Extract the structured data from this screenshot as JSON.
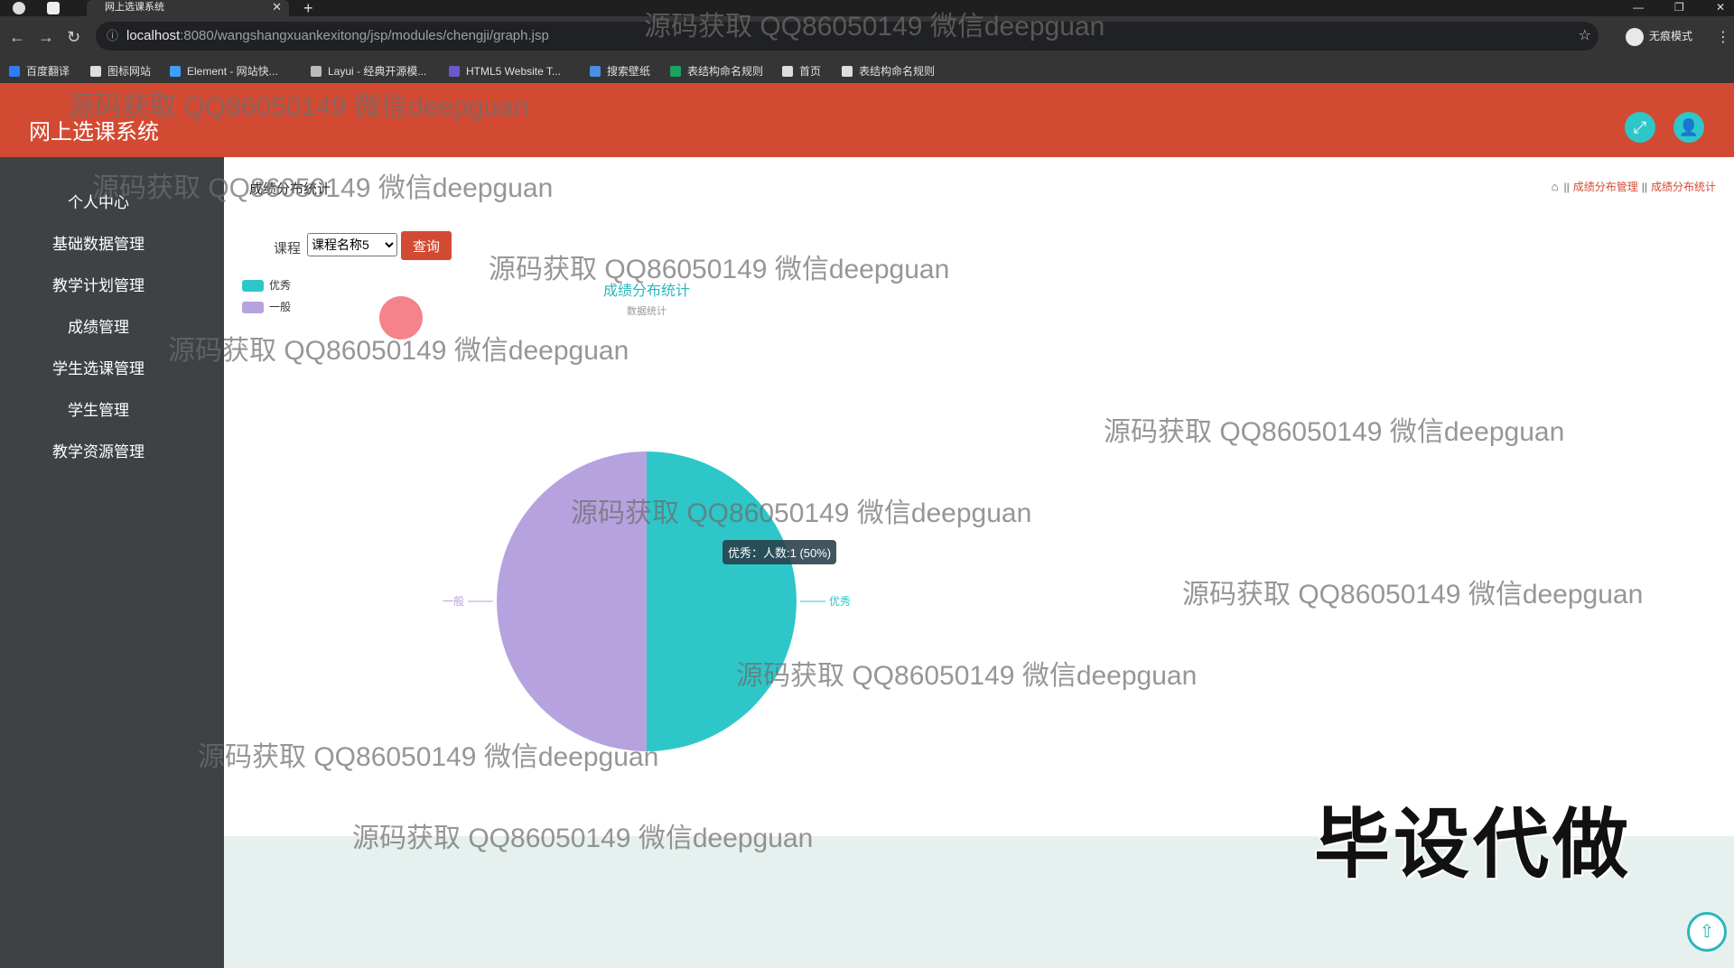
{
  "browser": {
    "tab_title": "网上选课系统",
    "url_host": "localhost",
    "url_path": ":8080/wangshangxuankexitong/jsp/modules/chengji/graph.jsp",
    "profile_label": "无痕模式",
    "bookmarks": [
      {
        "label": "百度翻译",
        "color": "#2e7cf6"
      },
      {
        "label": "图标网站",
        "color": "#dddddd"
      },
      {
        "label": "Element - 网站快...",
        "color": "#409eff"
      },
      {
        "label": "Layui - 经典开源模...",
        "color": "#bbbbbb"
      },
      {
        "label": "HTML5 Website T...",
        "color": "#6a5acd"
      },
      {
        "label": "搜索壁纸",
        "color": "#4a90e2"
      },
      {
        "label": "表结构命名规则",
        "color": "#1aa260"
      },
      {
        "label": "首页",
        "color": "#dddddd"
      },
      {
        "label": "表结构命名规则",
        "color": "#dddddd"
      }
    ]
  },
  "header": {
    "title": "网上选课系统",
    "color": "#d34a33"
  },
  "sidebar": {
    "items": [
      {
        "label": "个人中心"
      },
      {
        "label": "基础数据管理"
      },
      {
        "label": "教学计划管理"
      },
      {
        "label": "成绩管理"
      },
      {
        "label": "学生选课管理"
      },
      {
        "label": "学生管理"
      },
      {
        "label": "教学资源管理"
      }
    ]
  },
  "page": {
    "title": "成绩分布统计",
    "breadcrumb": [
      "成绩分布管理",
      "成绩分布统计"
    ]
  },
  "filter": {
    "label": "课程",
    "selected_option": "课程名称5",
    "query_button": "查询"
  },
  "chart_data": {
    "type": "pie",
    "title": "成绩分布统计",
    "subtitle": "数据统计",
    "legend_position": "top-left",
    "categories": [
      "优秀",
      "一般"
    ],
    "values": [
      1,
      1
    ],
    "colors": [
      "#2ec7c9",
      "#b6a2de"
    ],
    "tooltip": "优秀：人数:1 (50%)"
  },
  "overlays": {
    "watermark_text": "源码获取 QQ86050149 微信deepguan",
    "stamp_text": "毕设代做"
  }
}
